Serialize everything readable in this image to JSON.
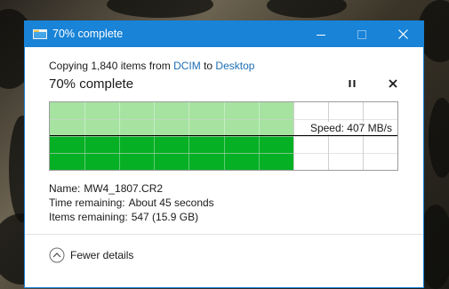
{
  "window": {
    "title": "70% complete",
    "accent_color": "#1883d7",
    "icons": {
      "app": "folder-copy-icon",
      "minimize": "minimize-icon",
      "maximize": "maximize-icon",
      "close": "close-icon"
    }
  },
  "copy": {
    "prefix": "Copying 1,840 items from ",
    "source": "DCIM",
    "middle": " to ",
    "destination": "Desktop"
  },
  "progress": {
    "headline": "70% complete",
    "percent": 70,
    "pause_icon": "pause-icon",
    "cancel_icon": "cancel-icon"
  },
  "graph": {
    "speed_label": "Speed: 407 MB/s",
    "filled_fraction": 0.7,
    "colors": {
      "bar_light": "#a6e3a1",
      "bar_dark": "#06b025",
      "grid": "#d0d0d0"
    }
  },
  "details": {
    "name_label": "Name:",
    "name_value": "MW4_1807.CR2",
    "time_label": "Time remaining:",
    "time_value": "About 45 seconds",
    "items_label": "Items remaining:",
    "items_value": "547 (15.9 GB)"
  },
  "footer": {
    "toggle_label": "Fewer details",
    "toggle_icon": "chevron-up-circle-icon"
  }
}
